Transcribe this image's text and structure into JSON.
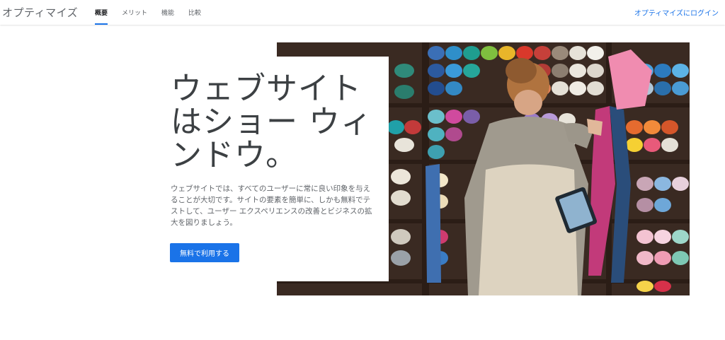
{
  "header": {
    "brand": "オプティマイズ",
    "tabs": [
      {
        "label": "概要",
        "active": true
      },
      {
        "label": "メリット",
        "active": false
      },
      {
        "label": "機能",
        "active": false
      },
      {
        "label": "比較",
        "active": false
      }
    ],
    "login": "オプティマイズにログイン"
  },
  "hero": {
    "headline": "ウェブサイト\nはショー ウィ\nンドウ。",
    "description": "ウェブサイトでは、すべてのユーザーに常に良い印象を与えることが大切です。サイトの要素を簡単に、しかも無料でテストして、ユーザー エクスペリエンスの改善とビジネスの拡大を図りましょう。",
    "cta": "無料で利用する"
  },
  "colors": {
    "accent": "#1a73e8",
    "text": "#3c4043",
    "muted": "#5f6368"
  }
}
